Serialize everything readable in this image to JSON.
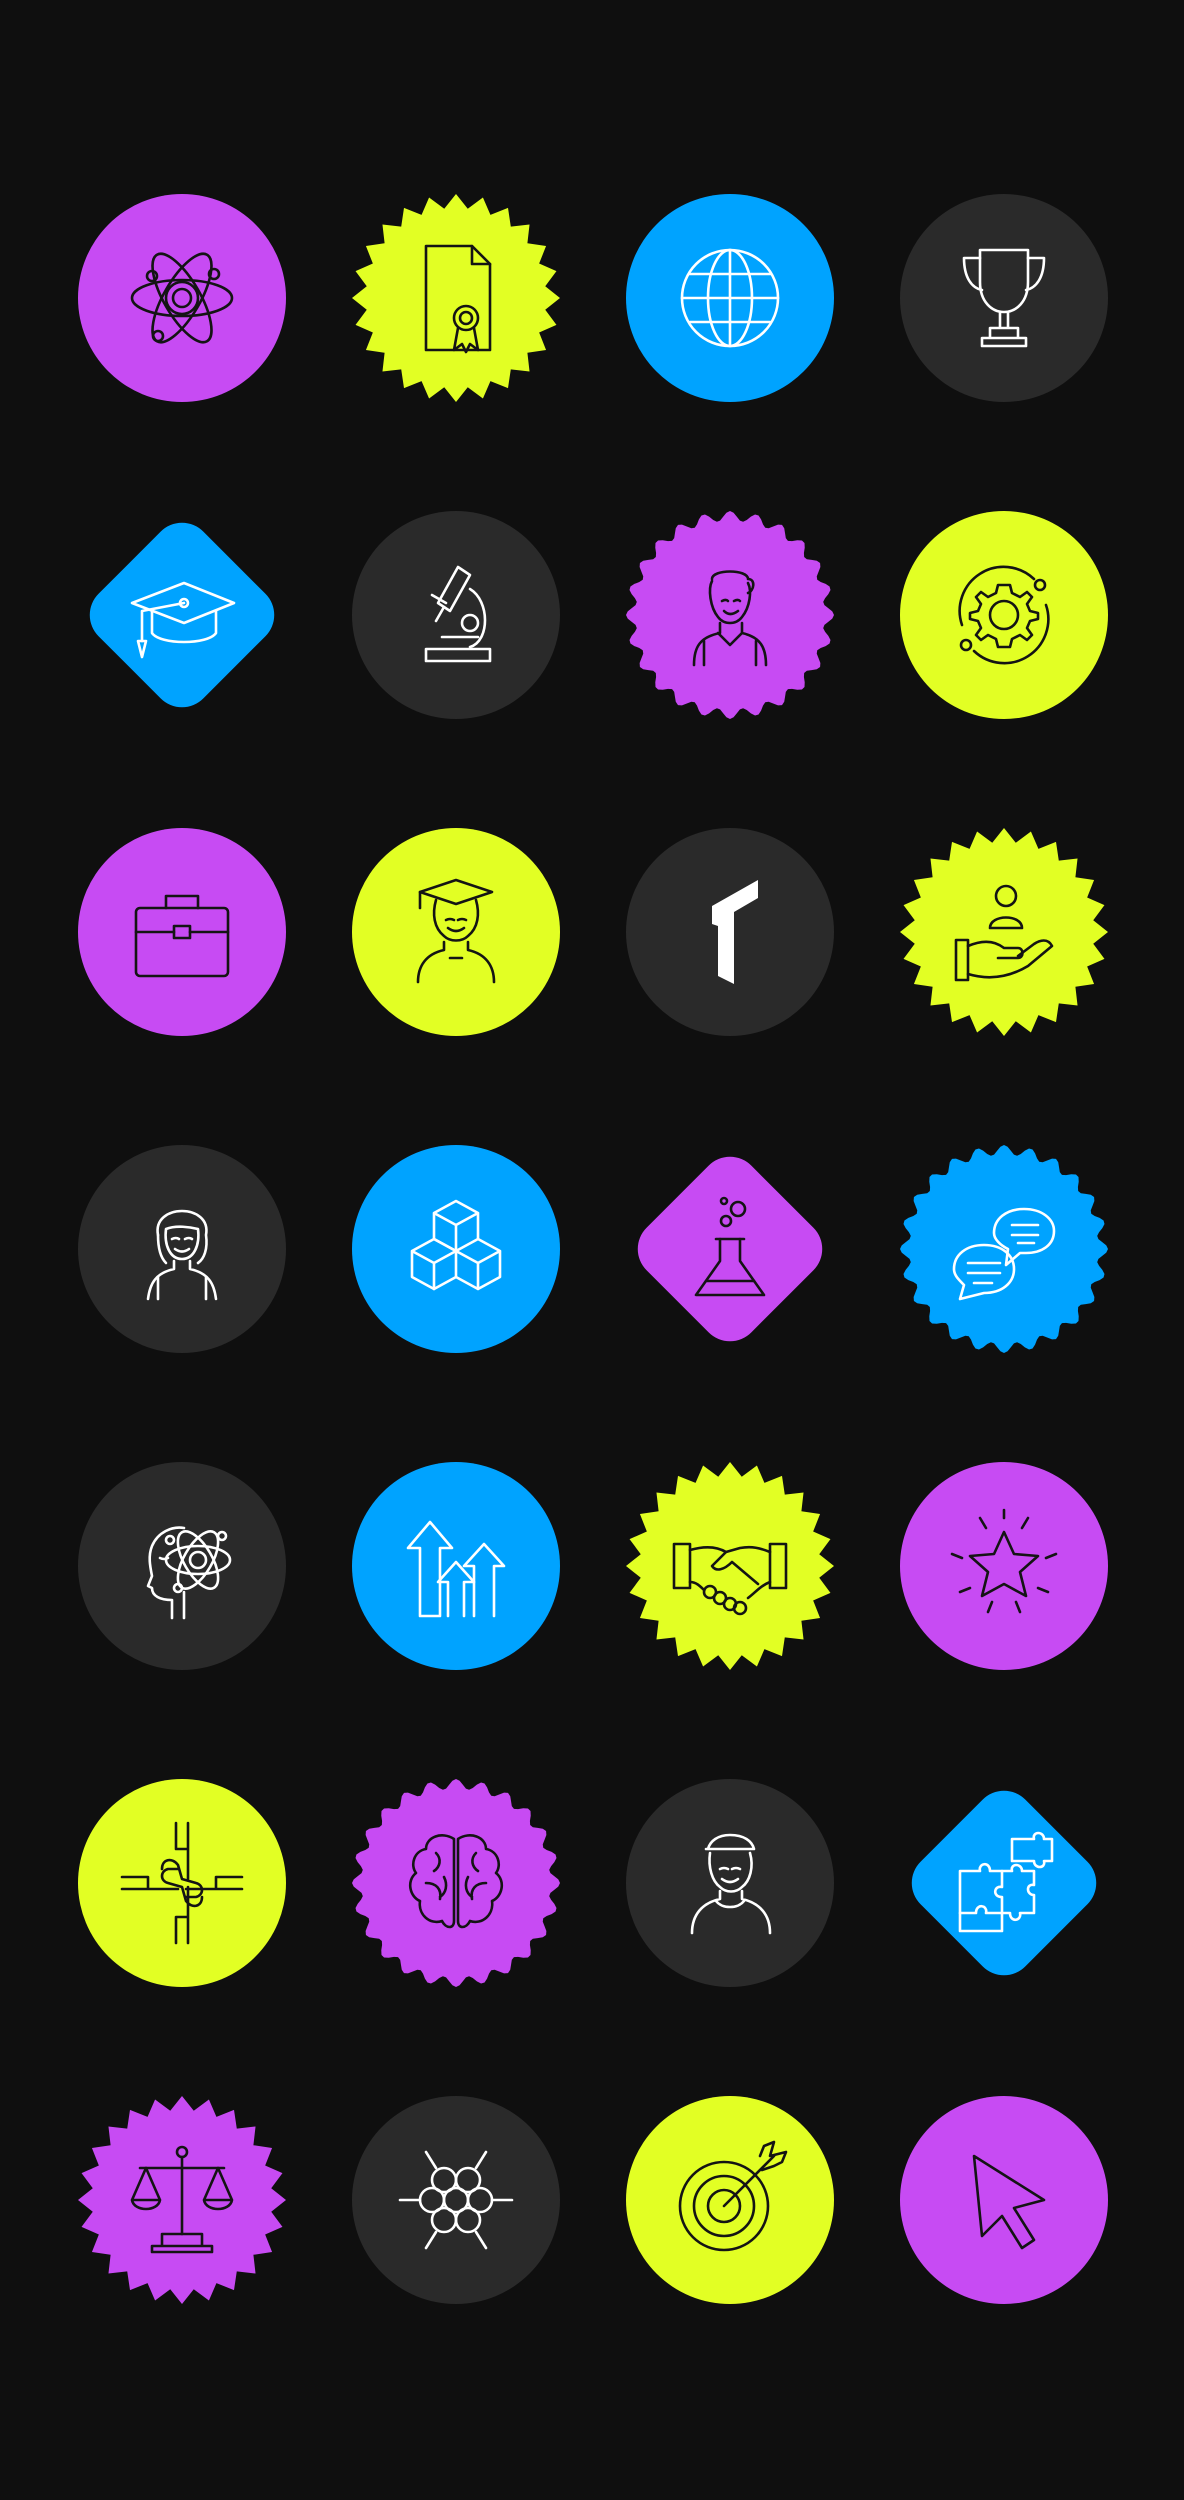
{
  "colors": {
    "background": "#0f0f0f",
    "purple": "#c74bf3",
    "lime": "#e2ff24",
    "blue": "#00a3ff",
    "dark": "#2a2a2a",
    "line_light": "#ffffff",
    "line_dark": "#141414"
  },
  "grid": {
    "columns": 4,
    "rows": 7
  },
  "icons": [
    {
      "icon": "atom-icon",
      "badge": "circle",
      "color": "purple"
    },
    {
      "icon": "certificate-icon",
      "badge": "burst",
      "color": "lime"
    },
    {
      "icon": "globe-icon",
      "badge": "circle",
      "color": "blue"
    },
    {
      "icon": "trophy-icon",
      "badge": "circle",
      "color": "dark"
    },
    {
      "icon": "graduation-cap-icon",
      "badge": "diamond",
      "color": "blue"
    },
    {
      "icon": "microscope-icon",
      "badge": "circle",
      "color": "dark"
    },
    {
      "icon": "student-boy-icon",
      "badge": "scallop",
      "color": "purple"
    },
    {
      "icon": "gear-orbit-icon",
      "badge": "circle",
      "color": "lime"
    },
    {
      "icon": "briefcase-icon",
      "badge": "circle",
      "color": "purple"
    },
    {
      "icon": "graduate-icon",
      "badge": "circle",
      "color": "lime"
    },
    {
      "icon": "logo-mark-icon",
      "badge": "circle",
      "color": "dark"
    },
    {
      "icon": "hand-person-icon",
      "badge": "burst",
      "color": "lime"
    },
    {
      "icon": "student-girl-icon",
      "badge": "circle",
      "color": "dark"
    },
    {
      "icon": "cubes-icon",
      "badge": "circle",
      "color": "blue"
    },
    {
      "icon": "flask-icon",
      "badge": "diamond",
      "color": "purple"
    },
    {
      "icon": "chat-bubbles-icon",
      "badge": "scallop",
      "color": "blue"
    },
    {
      "icon": "head-atom-icon",
      "badge": "circle",
      "color": "dark"
    },
    {
      "icon": "growth-arrows-icon",
      "badge": "circle",
      "color": "blue"
    },
    {
      "icon": "handshake-icon",
      "badge": "burst",
      "color": "lime"
    },
    {
      "icon": "star-burst-icon",
      "badge": "circle",
      "color": "purple"
    },
    {
      "icon": "teamwork-hands-icon",
      "badge": "circle",
      "color": "lime"
    },
    {
      "icon": "brain-icon",
      "badge": "scallop",
      "color": "purple"
    },
    {
      "icon": "man-cap-icon",
      "badge": "circle",
      "color": "dark"
    },
    {
      "icon": "puzzle-icon",
      "badge": "diamond",
      "color": "blue"
    },
    {
      "icon": "scales-icon",
      "badge": "burst",
      "color": "purple"
    },
    {
      "icon": "molecule-network-icon",
      "badge": "circle",
      "color": "dark"
    },
    {
      "icon": "target-arrow-icon",
      "badge": "circle",
      "color": "lime"
    },
    {
      "icon": "cursor-icon",
      "badge": "circle",
      "color": "purple"
    }
  ]
}
